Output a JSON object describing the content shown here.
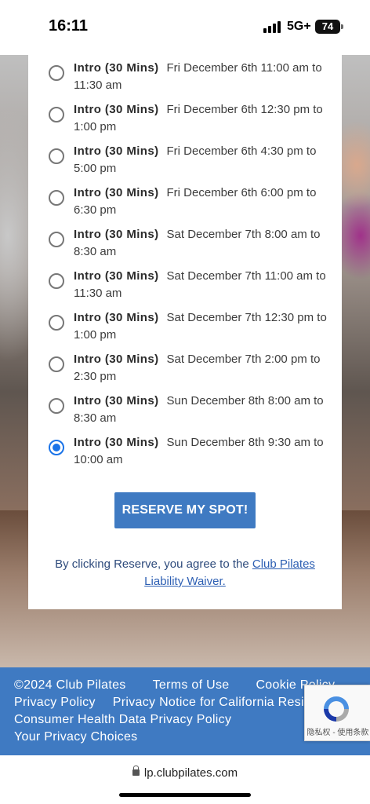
{
  "status_bar": {
    "time": "16:11",
    "network": "5G+",
    "battery": "74"
  },
  "options": [
    {
      "name": "Intro (30 Mins)",
      "detail": "Fri December 6th 11:00 am to 11:30 am",
      "selected": false
    },
    {
      "name": "Intro (30 Mins)",
      "detail": "Fri December 6th 12:30 pm to 1:00 pm",
      "selected": false
    },
    {
      "name": "Intro (30 Mins)",
      "detail": "Fri December 6th 4:30 pm to 5:00 pm",
      "selected": false
    },
    {
      "name": "Intro (30 Mins)",
      "detail": "Fri December 6th 6:00 pm to 6:30 pm",
      "selected": false
    },
    {
      "name": "Intro (30 Mins)",
      "detail": "Sat December 7th 8:00 am to 8:30 am",
      "selected": false
    },
    {
      "name": "Intro (30 Mins)",
      "detail": "Sat December 7th 11:00 am to 11:30 am",
      "selected": false
    },
    {
      "name": "Intro (30 Mins)",
      "detail": "Sat December 7th 12:30 pm to 1:00 pm",
      "selected": false
    },
    {
      "name": "Intro (30 Mins)",
      "detail": "Sat December 7th 2:00 pm to 2:30 pm",
      "selected": false
    },
    {
      "name": "Intro (30 Mins)",
      "detail": "Sun December 8th 8:00 am to 8:30 am",
      "selected": false
    },
    {
      "name": "Intro (30 Mins)",
      "detail": "Sun December 8th 9:30 am to 10:00 am",
      "selected": true
    }
  ],
  "reserve_button": "RESERVE MY SPOT!",
  "agreement": {
    "prefix": "By clicking Reserve, you agree to the ",
    "link_text": "Club Pilates Liability Waiver."
  },
  "footer": {
    "copyright": "©2024 Club Pilates",
    "terms": "Terms of Use",
    "cookie": "Cookie Policy",
    "privacy": "Privacy Policy",
    "privacy_ca": "Privacy Notice for California Residents",
    "consumer_health": "Consumer Health Data Privacy Policy",
    "choices": "Your Privacy Choices"
  },
  "recaptcha": {
    "label": "隐私权 - 使用条款"
  },
  "url_bar": {
    "url": "lp.clubpilates.com"
  },
  "colors": {
    "brand_blue": "#3f7ac2",
    "radio_selected": "#1a73e8"
  }
}
